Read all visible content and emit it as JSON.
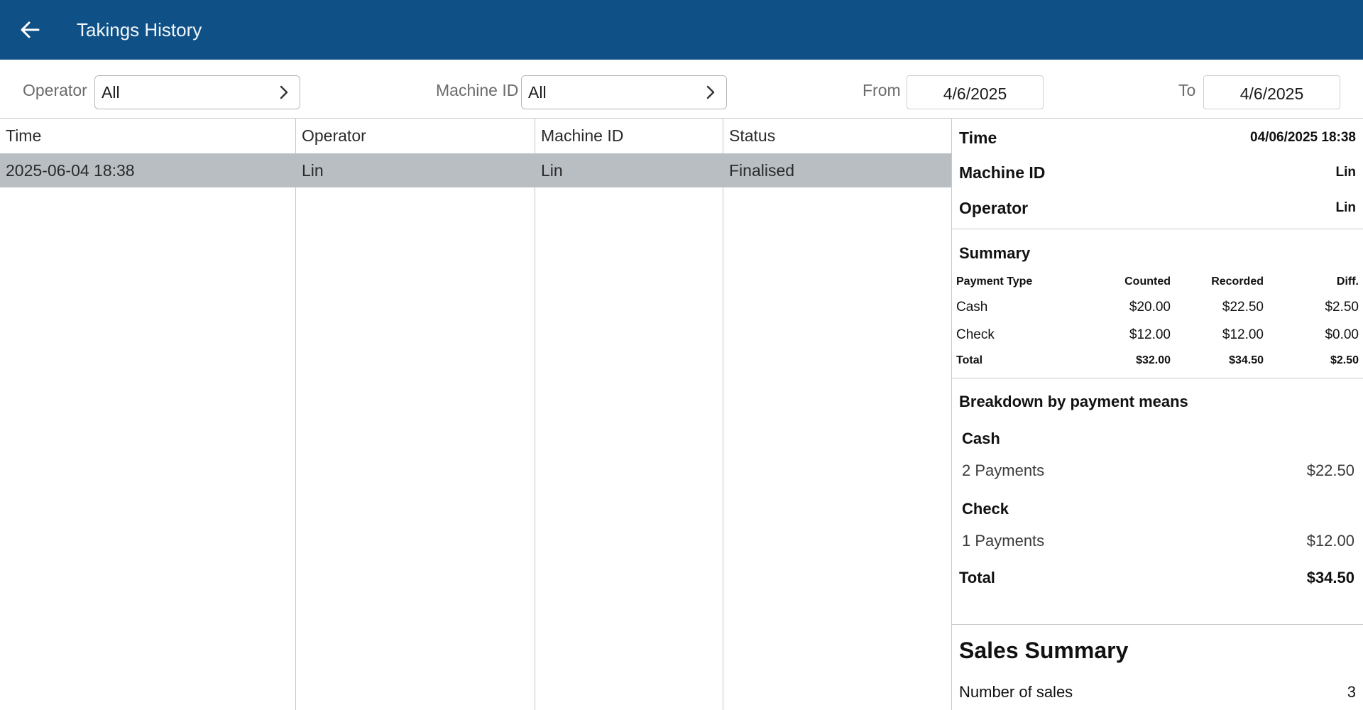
{
  "header": {
    "title": "Takings History",
    "back_icon": "arrow-left-icon",
    "bg_color": "#0f5186"
  },
  "filters": {
    "operator_label": "Operator",
    "operator_value": "All",
    "machine_label": "Machine ID",
    "machine_value": "All",
    "from_label": "From",
    "from_value": "4/6/2025",
    "to_label": "To",
    "to_value": "4/6/2025"
  },
  "table": {
    "columns": [
      "Time",
      "Operator",
      "Machine ID",
      "Status"
    ],
    "rows": [
      [
        "2025-06-04 18:38",
        "Lin",
        "Lin",
        "Finalised"
      ]
    ],
    "selected_row_color": "#b9bec3"
  },
  "details": {
    "time_label": "Time",
    "time_value": "04/06/2025 18:38",
    "machine_label": "Machine ID",
    "machine_value": "Lin",
    "operator_label": "Operator",
    "operator_value": "Lin",
    "summary": {
      "title": "Summary",
      "headers": [
        "Payment Type",
        "Counted",
        "Recorded",
        "Diff."
      ],
      "rows": [
        [
          "Cash",
          "$20.00",
          "$22.50",
          "$2.50"
        ],
        [
          "Check",
          "$12.00",
          "$12.00",
          "$0.00"
        ]
      ],
      "total": [
        "Total",
        "$32.00",
        "$34.50",
        "$2.50"
      ]
    },
    "breakdown": {
      "title": "Breakdown by payment means",
      "items": [
        {
          "name": "Cash",
          "count_label": "2 Payments",
          "amount": "$22.50"
        },
        {
          "name": "Check",
          "count_label": "1 Payments",
          "amount": "$12.00"
        }
      ],
      "total_label": "Total",
      "total_value": "$34.50"
    },
    "sales_summary": {
      "title": "Sales Summary",
      "number_of_sales_label": "Number of sales",
      "number_of_sales_value": "3"
    }
  }
}
